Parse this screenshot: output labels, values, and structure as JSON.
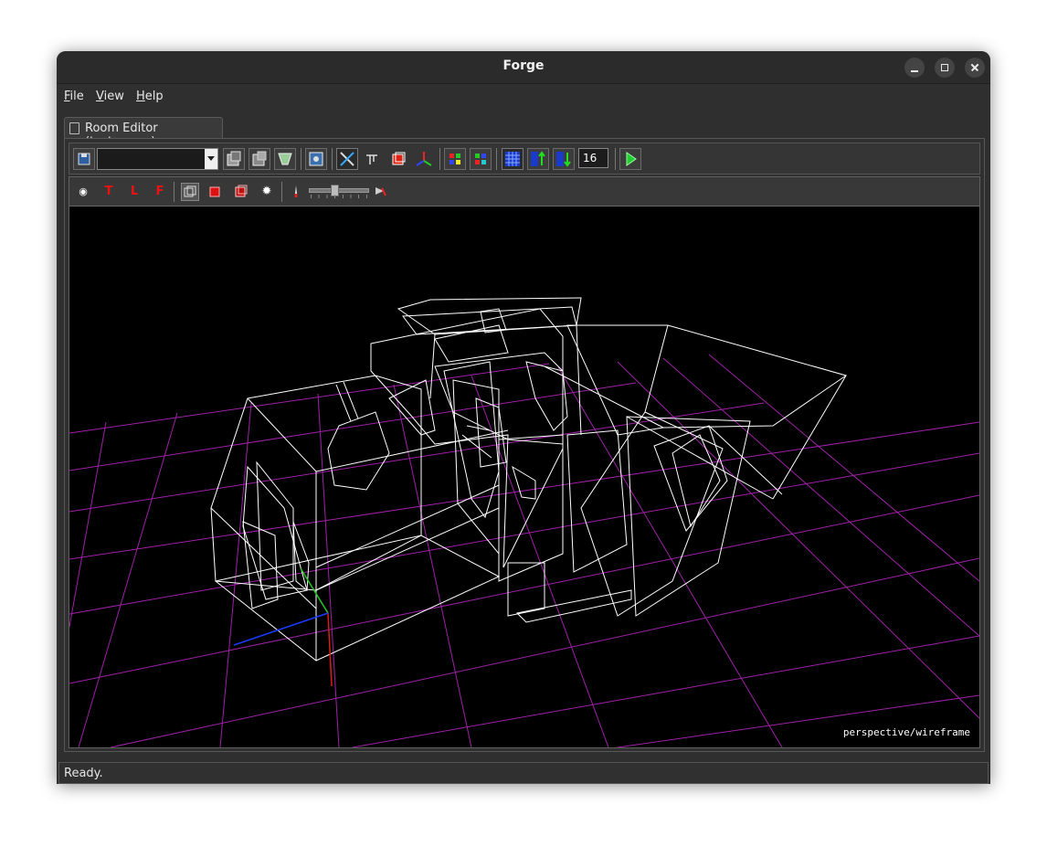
{
  "window": {
    "title": "Forge"
  },
  "menu": [
    {
      "label": "File"
    },
    {
      "label": "View"
    },
    {
      "label": "Help"
    }
  ],
  "tab": {
    "label": "Room Editor (test.rom.n)"
  },
  "toolbar": {
    "combo_value": "",
    "grid_size": "16",
    "icons": [
      "save-icon",
      "texture-a-icon",
      "texture-b-icon",
      "texture-c-icon",
      "image-icon",
      "select-icon",
      "tree-icon",
      "cube-icon",
      "axes-icon",
      "palette-a-icon",
      "palette-b-icon",
      "grid-icon",
      "move-up-icon",
      "move-down-icon",
      "play-icon"
    ]
  },
  "view_toolbar": {
    "eye": "◉",
    "top": "T",
    "left": "L",
    "front": "F",
    "light": "✹"
  },
  "viewport": {
    "mode": "perspective/wireframe"
  },
  "status": {
    "text": "Ready."
  },
  "colors": {
    "background": "#000000",
    "grid": "#a020a8",
    "wire": "#ffffff",
    "axis_x": "#e01a1a",
    "axis_y": "#22cc22",
    "axis_z": "#1a3aff"
  }
}
